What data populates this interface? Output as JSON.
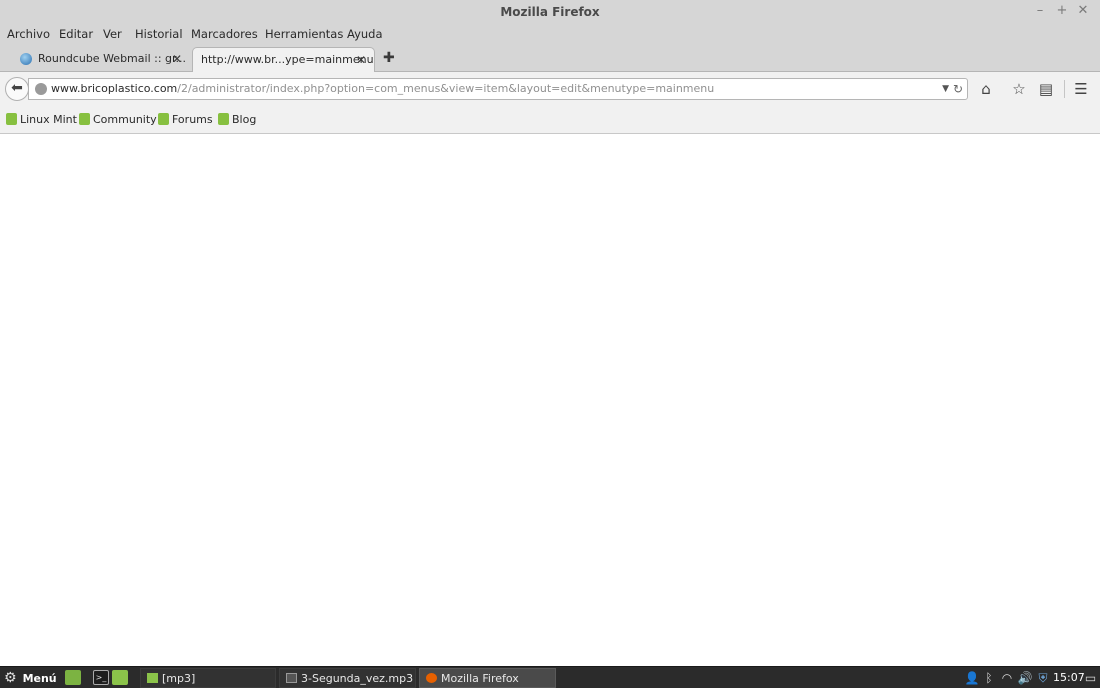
{
  "window": {
    "title": "Mozilla Firefox",
    "minimize_icon": "minimize-icon",
    "maximize_icon": "maximize-icon",
    "close_icon": "close-icon"
  },
  "menubar": {
    "items": [
      "Archivo",
      "Editar",
      "Ver",
      "Historial",
      "Marcadores",
      "Herramientas",
      "Ayuda"
    ]
  },
  "tabs": [
    {
      "label": "Roundcube Webmail :: gr...",
      "active": false,
      "favicon": "roundcube-icon"
    },
    {
      "label": "http://www.br...ype=mainmenu",
      "active": true,
      "favicon": ""
    }
  ],
  "navbar": {
    "url_host": "www.bricoplastico.com",
    "url_path": "/2/administrator/index.php?option=com_menus&view=item&layout=edit&menutype=mainmenu",
    "icons": [
      "back-arrow-icon",
      "globe-icon",
      "dropdown-icon",
      "reload-icon",
      "home-icon",
      "star-icon",
      "clipboard-icon",
      "hamburger-menu-icon"
    ]
  },
  "bookmarks": [
    "Linux Mint",
    "Community",
    "Forums",
    "Blog"
  ],
  "taskbar": {
    "menu_label": "Menú",
    "tasks": [
      "[mp3]",
      "3-Segunda_vez.mp3",
      "Mozilla Firefox"
    ],
    "clock": "15:07"
  },
  "colors": {
    "chrome": "#d6d6d6",
    "toolbar": "#f1f1f1",
    "taskbar": "#2b2b2b",
    "mint_green": "#87c040"
  }
}
